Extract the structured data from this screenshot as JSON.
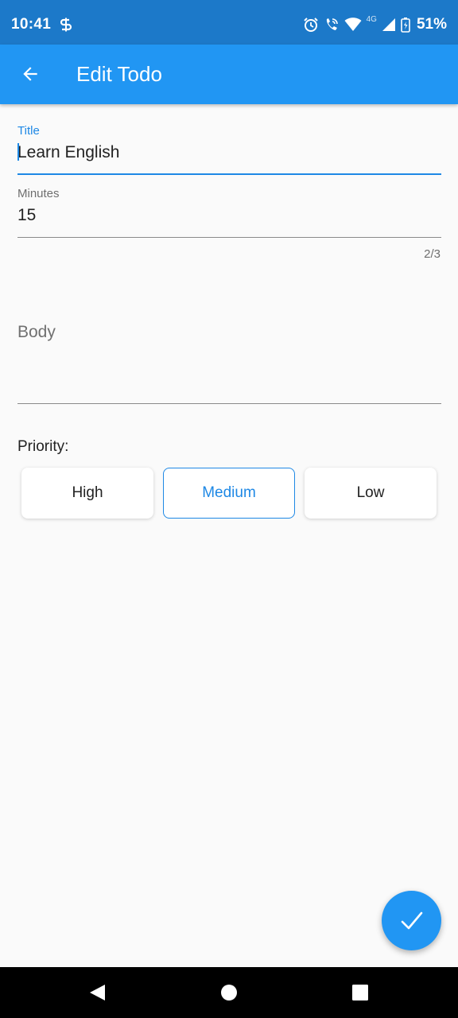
{
  "status_bar": {
    "time": "10:41",
    "network": "4G",
    "battery": "51%"
  },
  "app_bar": {
    "title": "Edit Todo"
  },
  "form": {
    "title_label": "Title",
    "title_value": "Learn English",
    "minutes_label": "Minutes",
    "minutes_value": "15",
    "minutes_counter": "2/3",
    "body_placeholder": "Body",
    "priority_label": "Priority:",
    "priority_options": [
      "High",
      "Medium",
      "Low"
    ],
    "priority_selected": "Medium"
  },
  "colors": {
    "accent": "#2196f3",
    "status_bar": "#1c79c9",
    "focus": "#1e88e5"
  },
  "icons": {
    "back": "arrow-back-icon",
    "fab": "check-icon"
  }
}
